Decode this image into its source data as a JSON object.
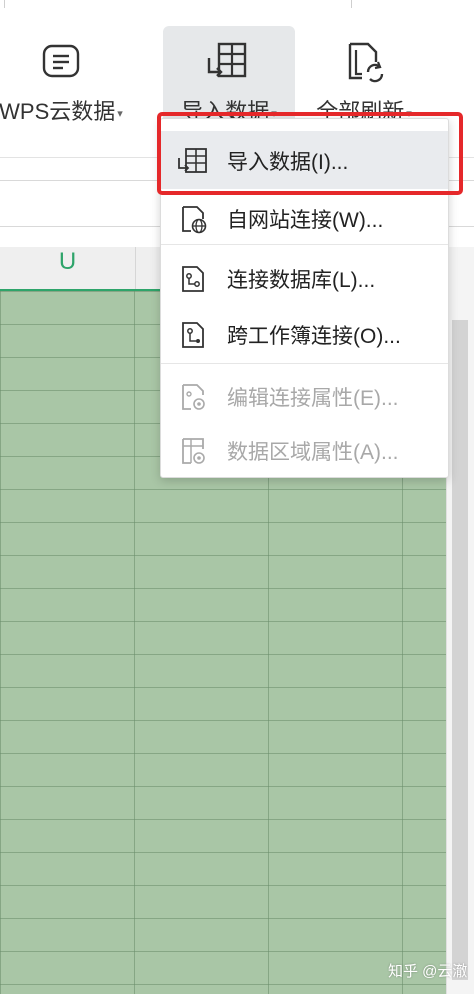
{
  "ribbon": {
    "wps_cloud_label": "WPS云数据",
    "import_label": "导入数据",
    "refresh_all_label": "全部刷新",
    "caret": "▾"
  },
  "column_header": {
    "active_column": "U"
  },
  "menu": {
    "items": [
      {
        "label": "导入数据(I)...",
        "icon": "import-data-icon",
        "enabled": true
      },
      {
        "label": "自网站连接(W)...",
        "icon": "web-connection-icon",
        "enabled": true
      },
      {
        "label": "连接数据库(L)...",
        "icon": "database-connection-icon",
        "enabled": true
      },
      {
        "label": "跨工作簿连接(O)...",
        "icon": "cross-workbook-connection-icon",
        "enabled": true
      },
      {
        "label": "编辑连接属性(E)...",
        "icon": "connection-properties-icon",
        "enabled": false
      },
      {
        "label": "数据区域属性(A)...",
        "icon": "data-range-properties-icon",
        "enabled": false
      }
    ]
  },
  "colors": {
    "highlight": "#e5282a",
    "grid_fill": "#a9c6a6",
    "column_accent": "#2ea46a"
  },
  "watermark": "知乎 @云澈"
}
